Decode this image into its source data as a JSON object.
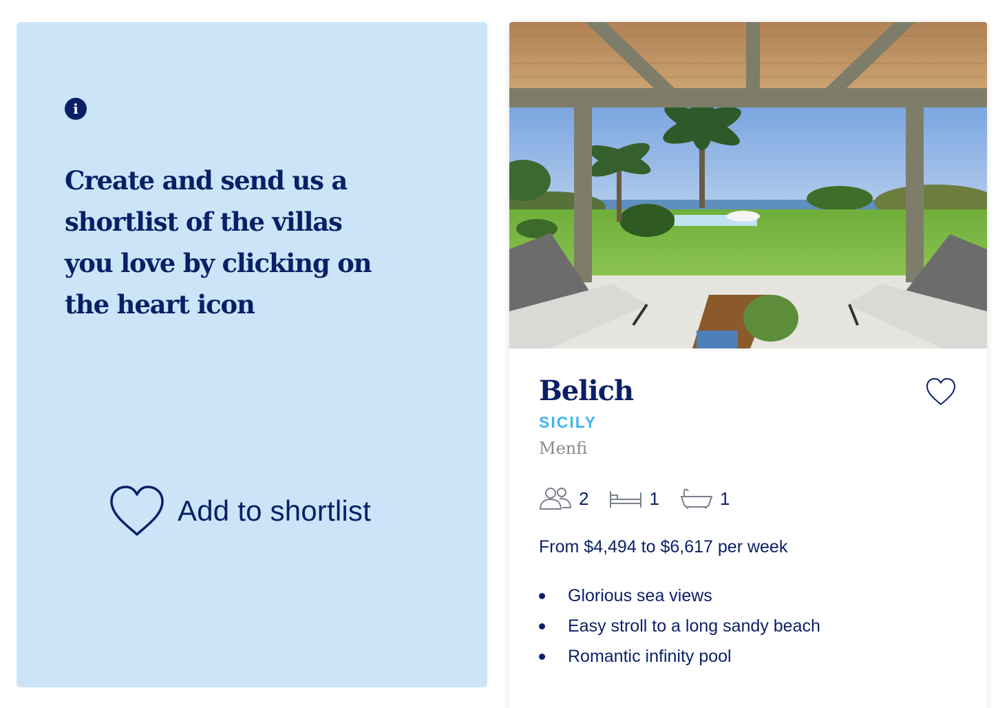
{
  "info_panel": {
    "icon": "info-icon",
    "icon_glyph": "i",
    "message": "Create and send us a shortlist of the villas you love by clicking on the heart icon",
    "demo": {
      "icon": "heart-outline-icon",
      "label": "Add to shortlist"
    }
  },
  "villa": {
    "photo": "covered terrace with sofas overlooking lawn, palm trees and sea",
    "name": "Belich",
    "region": "SICILY",
    "town": "Menfi",
    "favorite_icon": "heart-outline-icon",
    "amenities": [
      {
        "icon": "guests-icon",
        "value": "2"
      },
      {
        "icon": "bed-icon",
        "value": "1"
      },
      {
        "icon": "bath-icon",
        "value": "1"
      }
    ],
    "price": "From $4,494 to $6,617 per week",
    "features": [
      "Glorious sea views",
      "Easy stroll to a long sandy beach",
      "Romantic infinity pool"
    ]
  },
  "colors": {
    "navy": "#0b1f66",
    "panel_blue": "#cbe4f8",
    "region_blue": "#3db3f0",
    "muted_gray": "#8a8a8a"
  }
}
